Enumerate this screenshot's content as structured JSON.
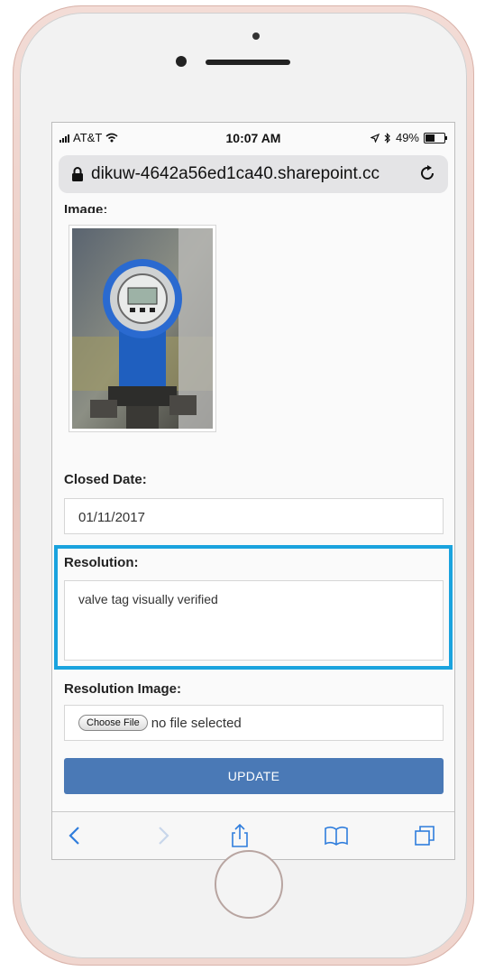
{
  "status_bar": {
    "carrier": "AT&T",
    "time": "10:07 AM",
    "battery": "49%",
    "battery_level": 0.49
  },
  "browser": {
    "url": "dikuw-4642a56ed1ca40.sharepoint.cc"
  },
  "form": {
    "image_label": "Image:",
    "closed_date_label": "Closed Date:",
    "closed_date_value": "01/11/2017",
    "resolution_label": "Resolution:",
    "resolution_value": "valve tag visually verified",
    "resolution_image_label": "Resolution Image:",
    "choose_file_label": "Choose File",
    "no_file_text": "no file selected",
    "update_label": "UPDATE"
  },
  "colors": {
    "highlight": "#1aa3de",
    "update_button": "#4a79b6"
  },
  "toolbar_icons": [
    "back-arrow-icon",
    "forward-arrow-icon",
    "share-icon",
    "bookmarks-icon",
    "tabs-icon"
  ]
}
